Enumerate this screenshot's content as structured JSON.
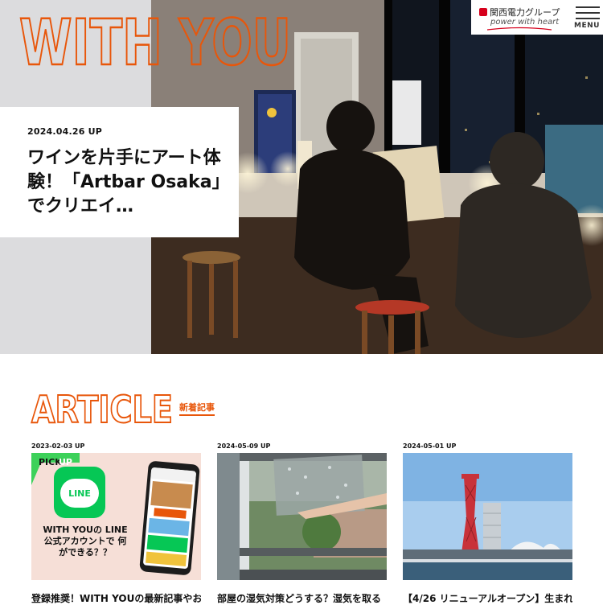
{
  "hero": {
    "logo_text": "WITH YOU",
    "date": "2024.04.26 UP",
    "title": "ワインを片手にアート体験！「Artbar Osaka」でクリエイ…"
  },
  "header": {
    "brand_name": "関西電力グループ",
    "brand_tagline": "power with heart",
    "menu_label": "MENU"
  },
  "section": {
    "title": "ARTICLE",
    "subtitle": "新着記事"
  },
  "articles": [
    {
      "date": "2023-02-03 UP",
      "title": "登録推奨！WITH YOUの最新記事やお",
      "pick_label": "PICK",
      "pick_sub": "UP",
      "line_word": "LINE",
      "line_copy": "WITH YOUの LINE公式アカウントで 何ができる？？"
    },
    {
      "date": "2024-05-09 UP",
      "title": "部屋の湿気対策どうする？湿気を取る"
    },
    {
      "date": "2024-05-01 UP",
      "title": "【4/26 リニューアルオープン】生まれ"
    }
  ],
  "colors": {
    "accent": "#e8560a",
    "line_green": "#06c755",
    "pick_green": "#3dd15a",
    "brand_red": "#d6001c"
  }
}
